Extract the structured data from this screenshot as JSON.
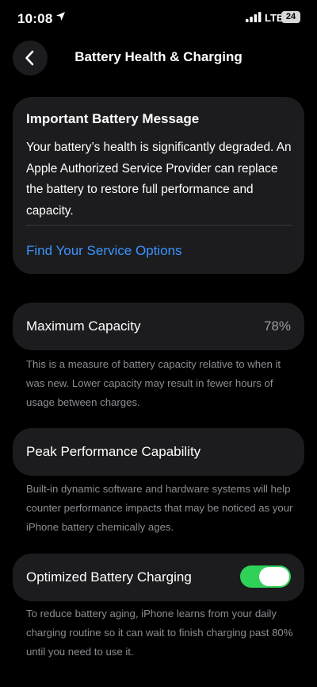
{
  "status": {
    "time": "10:08",
    "network": "LTE",
    "battery": "24",
    "icons": [
      "location-arrow-icon",
      "signal-icon",
      "battery-icon"
    ]
  },
  "nav": {
    "title": "Battery Health & Charging",
    "back_icon": "chevron-left-icon"
  },
  "message": {
    "title": "Important Battery Message",
    "body": "Your battery’s health is significantly degraded. An Apple Authorized Service Provider can replace the battery to restore full performance and capacity.",
    "link": "Find Your Service Options"
  },
  "capacity": {
    "label": "Maximum Capacity",
    "value": "78%",
    "footnote": "This is a measure of battery capacity relative to when it was new. Lower capacity may result in fewer hours of usage between charges."
  },
  "performance": {
    "label": "Peak Performance Capability",
    "footnote": "Built-in dynamic software and hardware systems will help counter performance impacts that may be noticed as your iPhone battery chemically ages."
  },
  "charging": {
    "label": "Optimized Battery Charging",
    "enabled": true,
    "footnote": "To reduce battery aging, iPhone learns from your daily charging routine so it can wait to finish charging past 80% until you need to use it."
  },
  "colors": {
    "background": "#000000",
    "card": "#1c1c1e",
    "link": "#3a94ff",
    "toggle_on": "#30d158",
    "secondary_text": "#8d8d93"
  }
}
